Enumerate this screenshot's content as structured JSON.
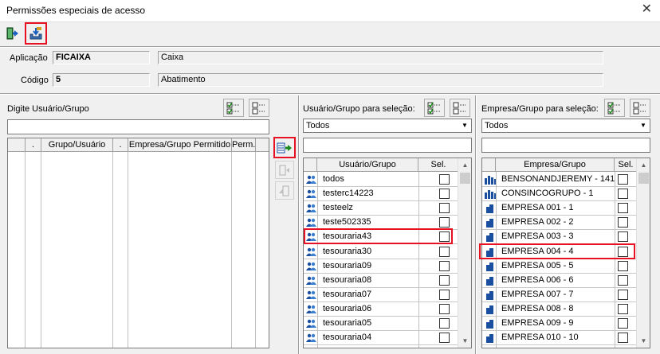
{
  "window": {
    "title": "Permissões especiais de acesso"
  },
  "header": {
    "aplicacao_label": "Aplicação",
    "aplicacao_code": "FICAIXA",
    "aplicacao_desc": "Caixa",
    "codigo_label": "Código",
    "codigo_value": "5",
    "codigo_desc": "Abatimento"
  },
  "left_panel": {
    "label": "Digite Usuário/Grupo",
    "columns": [
      ".",
      "Grupo/Usuário",
      ".",
      "Empresa/Grupo Permitido",
      "Perm."
    ]
  },
  "users_panel": {
    "label": "Usuário/Grupo para seleção:",
    "filter": "Todos",
    "columns": [
      ".",
      "Usuário/Grupo",
      "Sel."
    ],
    "rows": [
      "todos",
      "testerc14223",
      "testeelz",
      "teste502335",
      "tesouraria43",
      "tesouraria30",
      "tesouraria09",
      "tesouraria08",
      "tesouraria07",
      "tesouraria06",
      "tesouraria05",
      "tesouraria04"
    ]
  },
  "companies_panel": {
    "label": "Empresa/Grupo para seleção:",
    "filter": "Todos",
    "columns": [
      ".",
      "Empresa/Grupo",
      "Sel."
    ],
    "rows": [
      "BENSONANDJEREMY - 141",
      "CONSINCOGRUPO - 1",
      "EMPRESA 001 - 1",
      "EMPRESA 002 - 2",
      "EMPRESA 003 - 3",
      "EMPRESA 004 - 4",
      "EMPRESA 005 - 5",
      "EMPRESA 006 - 6",
      "EMPRESA 007 - 7",
      "EMPRESA 008 - 8",
      "EMPRESA 009 - 9",
      "EMPRESA 010 - 10"
    ]
  },
  "colors": {
    "highlight": "#e81123",
    "user_icon": "#1a4fa0"
  }
}
